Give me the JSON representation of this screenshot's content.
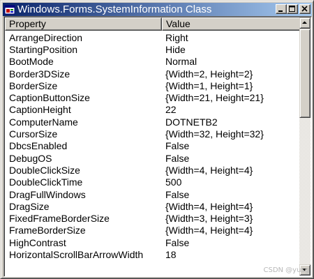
{
  "window": {
    "title": "Windows.Forms.SystemInformation Class",
    "app_icon": "form-window-icon",
    "buttons": [
      "minimize-icon",
      "maximize-icon",
      "close-icon"
    ]
  },
  "listview": {
    "columns": [
      "Property",
      "Value"
    ],
    "rows": [
      [
        "ArrangeDirection",
        "Right"
      ],
      [
        "StartingPosition",
        "Hide"
      ],
      [
        "BootMode",
        "Normal"
      ],
      [
        "Border3DSize",
        "{Width=2, Height=2}"
      ],
      [
        "BorderSize",
        "{Width=1, Height=1}"
      ],
      [
        "CaptionButtonSize",
        "{Width=21, Height=21}"
      ],
      [
        "CaptionHeight",
        "22"
      ],
      [
        "ComputerName",
        "DOTNETB2"
      ],
      [
        "CursorSize",
        "{Width=32, Height=32}"
      ],
      [
        "DbcsEnabled",
        "False"
      ],
      [
        "DebugOS",
        "False"
      ],
      [
        "DoubleClickSize",
        "{Width=4, Height=4}"
      ],
      [
        "DoubleClickTime",
        "500"
      ],
      [
        "DragFullWindows",
        "False"
      ],
      [
        "DragSize",
        "{Width=4, Height=4}"
      ],
      [
        "FixedFrameBorderSize",
        "{Width=3, Height=3}"
      ],
      [
        "FrameBorderSize",
        "{Width=4, Height=4}"
      ],
      [
        "HighContrast",
        "False"
      ],
      [
        "HorizontalScrollBarArrowWidth",
        "18"
      ]
    ]
  },
  "scrollbar": {
    "position_fraction": 0.0
  },
  "watermark": "CSDN @yusg",
  "colors": {
    "title_start": "#0a246a",
    "title_end": "#a6caf0",
    "face": "#d4d0c8"
  }
}
